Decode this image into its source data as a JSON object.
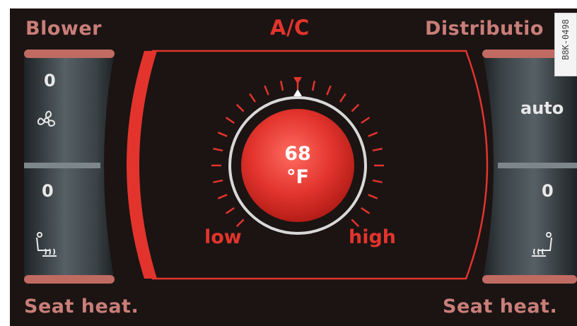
{
  "header": {
    "left_label": "Blower",
    "center_label": "A/C",
    "right_label": "Distributio"
  },
  "footer": {
    "left_label": "Seat heat.",
    "right_label": "Seat heat."
  },
  "left_wheel": {
    "blower_value": "0",
    "blower_icon": "fan-icon",
    "seat_value": "0",
    "seat_icon": "seat-heat-icon"
  },
  "right_wheel": {
    "distribution_value": "auto",
    "seat_value": "0",
    "seat_icon": "seat-heat-icon"
  },
  "temperature": {
    "value": "68",
    "unit": "°F",
    "low_label": "low",
    "high_label": "high"
  },
  "image_tag": "B8K-0498",
  "colors": {
    "accent_red": "#e2342d",
    "label_pink": "#c97e78",
    "background": "#1b1413"
  }
}
